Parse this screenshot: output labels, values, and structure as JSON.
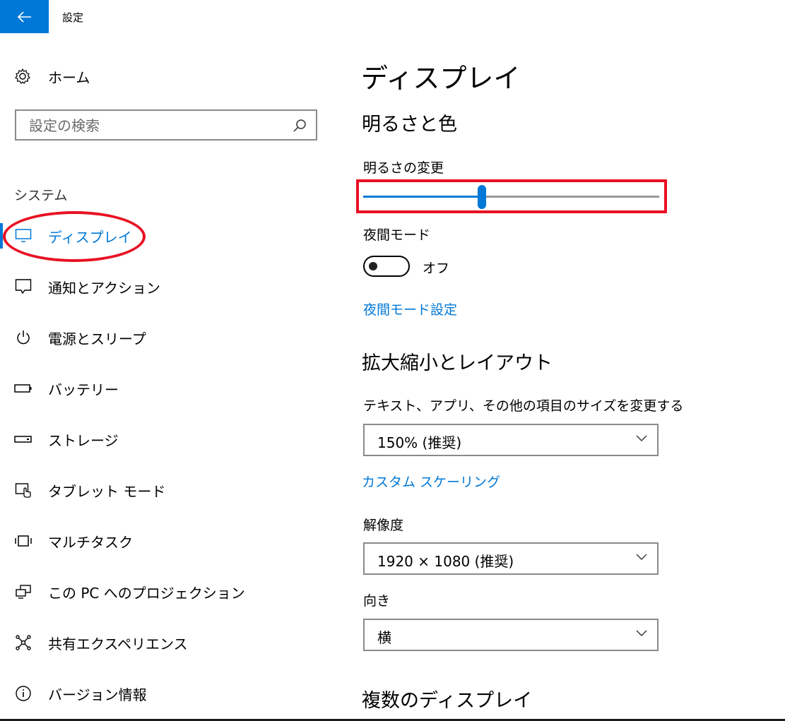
{
  "window": {
    "title": "設定",
    "back_icon": "arrow-left-icon",
    "accent": "#0078d7"
  },
  "sidebar": {
    "home": {
      "label": "ホーム",
      "icon": "gear-icon"
    },
    "search": {
      "placeholder": "設定の検索",
      "value": "",
      "icon": "search-icon"
    },
    "section": "システム",
    "items": [
      {
        "label": "ディスプレイ",
        "icon": "monitor-icon",
        "active": true
      },
      {
        "label": "通知とアクション",
        "icon": "notification-icon"
      },
      {
        "label": "電源とスリープ",
        "icon": "power-icon"
      },
      {
        "label": "バッテリー",
        "icon": "battery-icon"
      },
      {
        "label": "ストレージ",
        "icon": "storage-icon"
      },
      {
        "label": "タブレット モード",
        "icon": "tablet-mode-icon"
      },
      {
        "label": "マルチタスク",
        "icon": "multitask-icon"
      },
      {
        "label": "この PC へのプロジェクション",
        "icon": "projection-icon"
      },
      {
        "label": "共有エクスペリエンス",
        "icon": "shared-experience-icon"
      },
      {
        "label": "バージョン情報",
        "icon": "info-icon"
      }
    ]
  },
  "main": {
    "title": "ディスプレイ",
    "brightness_section": {
      "heading": "明るさと色",
      "brightness_label": "明るさの変更",
      "brightness_value": 0.4,
      "night_mode_label": "夜間モード",
      "night_mode_state": "オフ",
      "night_mode_link": "夜間モード設定"
    },
    "scale_section": {
      "heading": "拡大縮小とレイアウト",
      "scale_label": "テキスト、アプリ、その他の項目のサイズを変更する",
      "scale_value": "150% (推奨)",
      "custom_scaling_link": "カスタム スケーリング",
      "resolution_label": "解像度",
      "resolution_value": "1920 × 1080 (推奨)",
      "orientation_label": "向き",
      "orientation_value": "横"
    },
    "multi_display_heading": "複数のディスプレイ"
  },
  "annotations": {
    "highlight_color": "#e81123"
  }
}
